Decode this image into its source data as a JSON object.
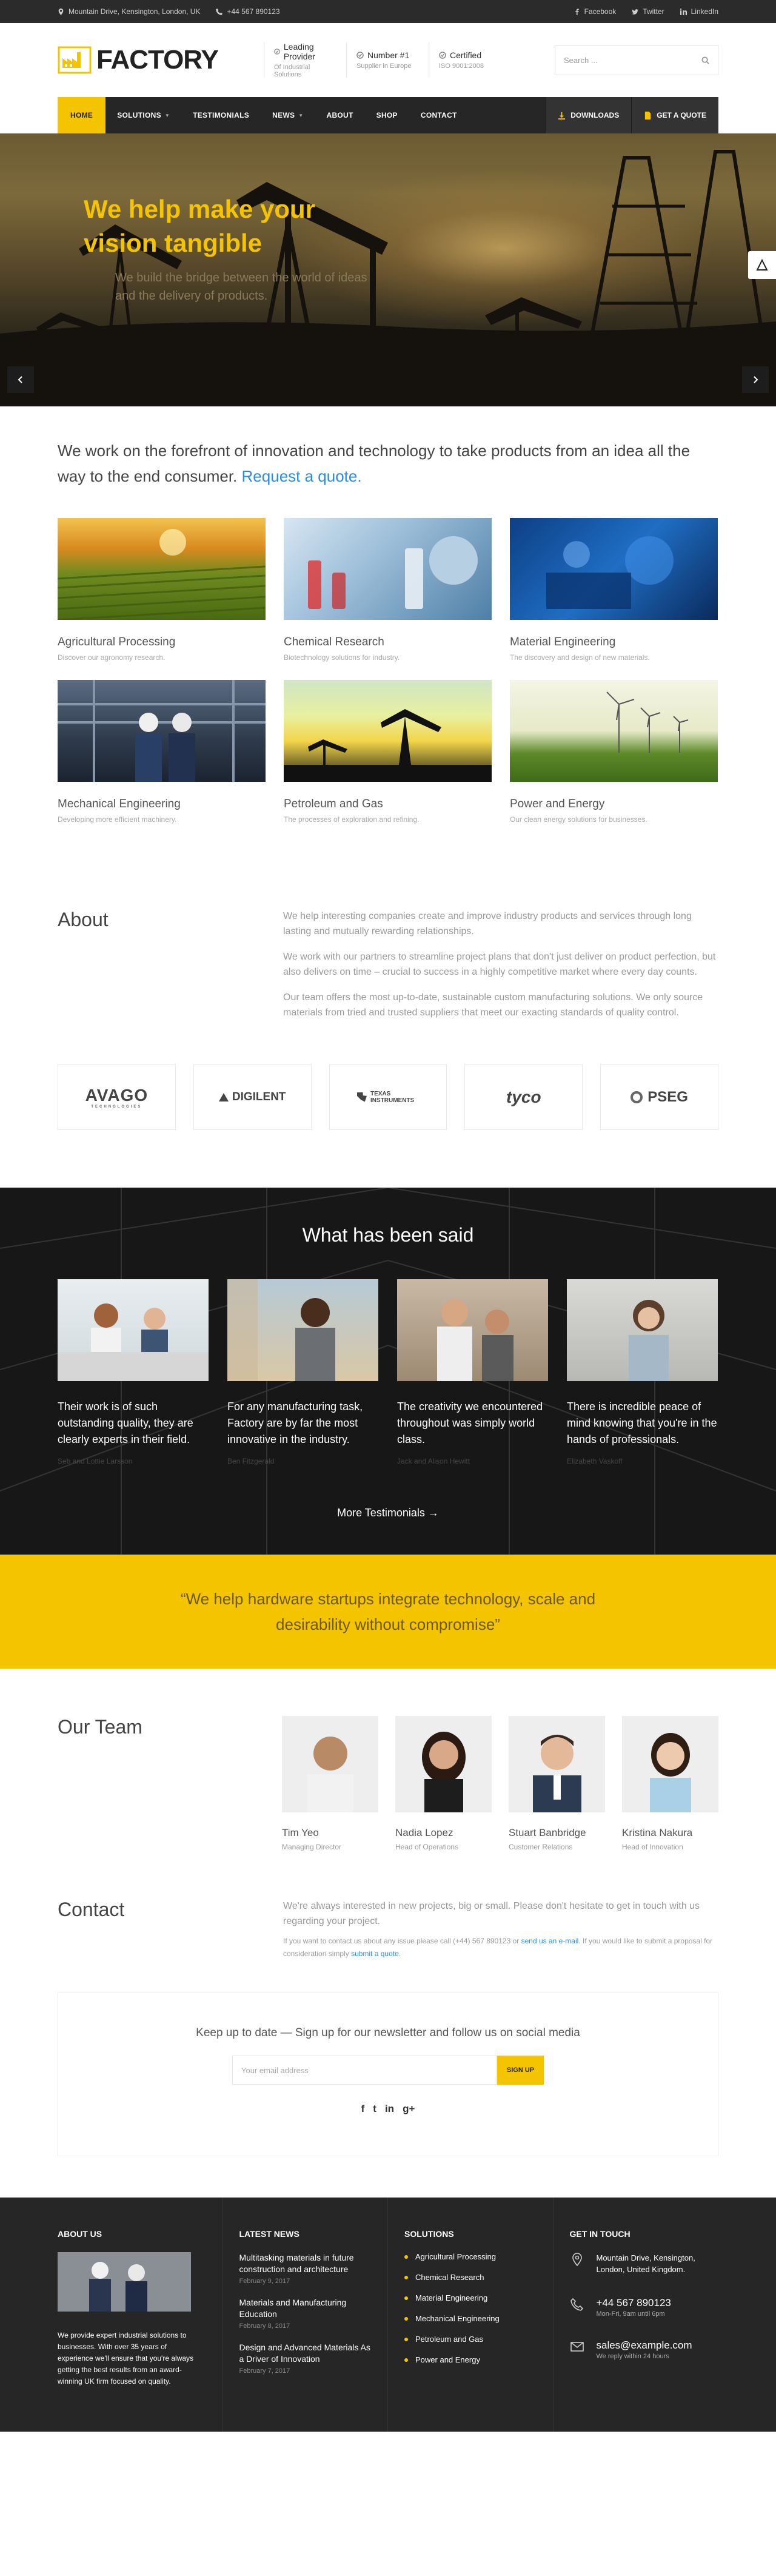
{
  "topbar": {
    "address": "Mountain Drive, Kensington, London, UK",
    "phone": "+44 567 890123",
    "social": [
      "Facebook",
      "Twitter",
      "LinkedIn"
    ]
  },
  "brand": {
    "name": "FACTORY"
  },
  "features": [
    {
      "title": "Leading Provider",
      "sub": "Of Industrial Solutions"
    },
    {
      "title": "Number #1",
      "sub": "Supplier in Europe"
    },
    {
      "title": "Certified",
      "sub": "ISO 9001:2008"
    }
  ],
  "search": {
    "placeholder": "Search ..."
  },
  "nav": {
    "items": [
      "HOME",
      "SOLUTIONS",
      "TESTIMONIALS",
      "NEWS",
      "ABOUT",
      "SHOP",
      "CONTACT"
    ],
    "downloads": "DOWNLOADS",
    "quote": "GET A QUOTE"
  },
  "hero": {
    "title": "We help make your vision tangible",
    "subtitle": "We build the bridge between the world of ideas and the delivery of products."
  },
  "intro": {
    "text": "We work on the forefront of innovation and technology to take products from an idea all the way to the end consumer.",
    "link": "Request a quote."
  },
  "services": [
    {
      "title": "Agricultural Processing",
      "desc": "Discover our agronomy research."
    },
    {
      "title": "Chemical Research",
      "desc": "Biotechnology solutions for industry."
    },
    {
      "title": "Material Engineering",
      "desc": "The discovery and design of new materials."
    },
    {
      "title": "Mechanical Engineering",
      "desc": "Developing more efficient machinery."
    },
    {
      "title": "Petroleum and Gas",
      "desc": "The processes of exploration and refining."
    },
    {
      "title": "Power and Energy",
      "desc": "Our clean energy solutions for businesses."
    }
  ],
  "about": {
    "title": "About",
    "paragraphs": [
      "We help interesting companies create and improve industry products and services through long lasting and mutually rewarding relationships.",
      "We work with our partners to streamline project plans that don't just deliver on product perfection, but also delivers on time – crucial to success in a highly competitive market where every day counts.",
      "Our team offers the most up-to-date, sustainable custom manufacturing solutions. We only source materials from tried and trusted suppliers that meet our exacting standards of quality control."
    ]
  },
  "logos": [
    "AVAGO",
    "DIGILENT",
    "TEXAS INSTRUMENTS",
    "tyco",
    "PSEG"
  ],
  "logo_sub": {
    "avago": "TECHNOLOGIES"
  },
  "testimonials": {
    "title": "What has been said",
    "items": [
      {
        "quote": "Their work is of such outstanding quality, they are clearly experts in their field.",
        "name": "Seb and Lottie Larsson"
      },
      {
        "quote": "For any manufacturing task, Factory are by far the most innovative in the industry.",
        "name": "Ben Fitzgerald"
      },
      {
        "quote": "The creativity we encountered throughout was simply world class.",
        "name": "Jack and Alison Hewitt"
      },
      {
        "quote": "There is incredible peace of mind knowing that you're in the hands of professionals.",
        "name": "Elizabeth Vaskoff"
      }
    ],
    "more": "More Testimonials →"
  },
  "quote": {
    "text": "“We help hardware startups integrate technology, scale and desirability without compromise”"
  },
  "team": {
    "title": "Our Team",
    "members": [
      {
        "name": "Tim Yeo",
        "role": "Managing Director"
      },
      {
        "name": "Nadia Lopez",
        "role": "Head of Operations"
      },
      {
        "name": "Stuart Banbridge",
        "role": "Customer Relations"
      },
      {
        "name": "Kristina Nakura",
        "role": "Head of Innovation"
      }
    ]
  },
  "contact": {
    "title": "Contact",
    "lead": "We're always interested in new projects, big or small. Please don't hesitate to get in touch with us regarding your project.",
    "small_1": "If you want to contact us about any issue please call (+44) 567 890123 or",
    "small_link_1": "send us an e-mail",
    "small_2": ". If you would like to submit a proposal for consideration simply",
    "small_link_2": "submit a quote",
    "small_3": "."
  },
  "newsletter": {
    "title": "Keep up to date — Sign up for our newsletter and follow us on social media",
    "placeholder": "Your email address",
    "button": "SIGN UP",
    "socials": [
      "f",
      "t",
      "in",
      "g+"
    ]
  },
  "footer": {
    "about": {
      "title": "ABOUT US",
      "text": "We provide expert industrial solutions to businesses. With over 35 years of experience we'll ensure that you're always getting the best results from an award-winning UK firm focused on quality."
    },
    "news": {
      "title": "LATEST NEWS",
      "items": [
        {
          "title": "Multitasking materials in future construction and architecture",
          "date": "February 9, 2017"
        },
        {
          "title": "Materials and Manufacturing Education",
          "date": "February 8, 2017"
        },
        {
          "title": "Design and Advanced Materials As a Driver of Innovation",
          "date": "February 7, 2017"
        }
      ]
    },
    "solutions": {
      "title": "SOLUTIONS",
      "items": [
        "Agricultural Processing",
        "Chemical Research",
        "Material Engineering",
        "Mechanical Engineering",
        "Petroleum and Gas",
        "Power and Energy"
      ]
    },
    "touch": {
      "title": "GET IN TOUCH",
      "address": "Mountain Drive, Kensington, London, United Kingdom.",
      "phone": "+44 567 890123",
      "hours": "Mon-Fri, 9am until 6pm",
      "email": "sales@example.com",
      "reply": "We reply within 24 hours"
    }
  },
  "colors": {
    "accent": "#f5c400",
    "dark": "#262626",
    "link": "#2a8be0"
  }
}
